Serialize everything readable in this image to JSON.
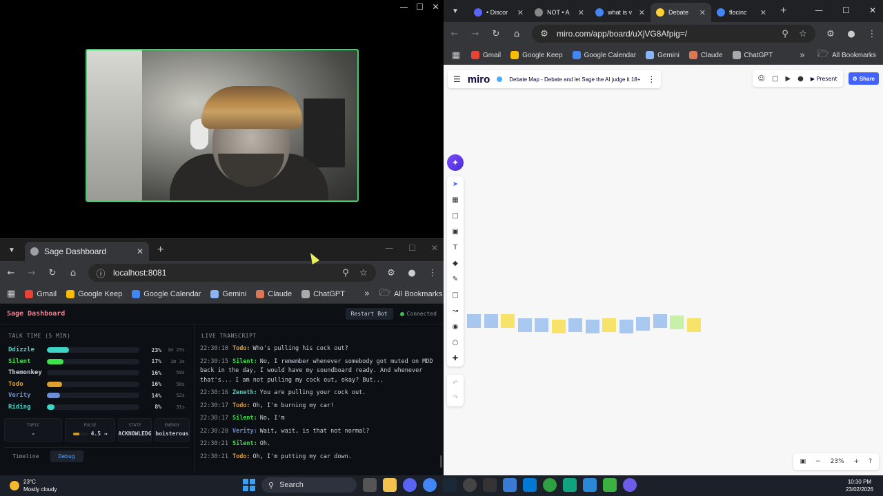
{
  "dashboard_browser": {
    "tab_title": "Sage Dashboard",
    "url": "localhost:8081",
    "bookmarks": [
      "Gmail",
      "Google Keep",
      "Google Calendar",
      "Gemini",
      "Claude",
      "ChatGPT"
    ],
    "all_bookmarks": "All Bookmarks"
  },
  "dashboard": {
    "title": "Sage Dashboard",
    "restart_label": "Restart Bot",
    "status": "Connected",
    "talk_time_label": "TALK TIME (5 MIN)",
    "talk": [
      {
        "name": "Ddizzle",
        "pct": "23%",
        "dur": "1m 23s",
        "fill": 0.23,
        "color": "#3dd6c6"
      },
      {
        "name": "Silent",
        "pct": "17%",
        "dur": "1m 3s",
        "fill": 0.17,
        "color": "#3fe04a"
      },
      {
        "name": "Themonkey",
        "pct": "16%",
        "dur": "59s",
        "fill": 0.0,
        "color": "#c9d1d9"
      },
      {
        "name": "Todo",
        "pct": "16%",
        "dur": "58s",
        "fill": 0.16,
        "color": "#e0a030"
      },
      {
        "name": "Verity",
        "pct": "14%",
        "dur": "52s",
        "fill": 0.14,
        "color": "#6b8fd6"
      },
      {
        "name": "Riding",
        "pct": "8%",
        "dur": "31s",
        "fill": 0.08,
        "color": "#3dd6c6"
      }
    ],
    "cards": {
      "topic_label": "TOPIC",
      "topic_value": "-",
      "pulse_label": "PULSE",
      "pulse_value": "4.5 →",
      "pulse_fill": 0.45,
      "state_label": "STATE",
      "state_value": "ACKNOWLEDG",
      "energy_label": "ENERGY",
      "energy_value": "boisterous"
    },
    "subtabs": [
      "Timeline",
      "Debug"
    ],
    "transcript_label": "LIVE TRANSCRIPT",
    "transcript": [
      {
        "time": "22:30:10",
        "speaker": "Todo:",
        "color": "#e0a030",
        "text": "Who's pulling his cock out?"
      },
      {
        "time": "22:30:15",
        "speaker": "Silent:",
        "color": "#3fe04a",
        "text": "No, I remember whenever somebody got muted on MDD back in the day, I would have my soundboard ready. And whenever that's... I am not pulling my cock out, okay? But..."
      },
      {
        "time": "22:30:16",
        "speaker": "Zeneth:",
        "color": "#3dd6c6",
        "text": "You are pulling your cock out."
      },
      {
        "time": "22:30:17",
        "speaker": "Todo:",
        "color": "#e0a030",
        "text": "Oh, I'm burning my car!"
      },
      {
        "time": "22:30:17",
        "speaker": "Silent:",
        "color": "#3fe04a",
        "text": "No, I'm"
      },
      {
        "time": "22:30:20",
        "speaker": "Verity:",
        "color": "#6b8fd6",
        "text": "Wait, wait, is that not normal?"
      },
      {
        "time": "22:30:21",
        "speaker": "Silent:",
        "color": "#3fe04a",
        "text": "Oh."
      },
      {
        "time": "22:30:21",
        "speaker": "Todo:",
        "color": "#e0a030",
        "text": "Oh, I'm putting my car down."
      }
    ]
  },
  "miro_browser": {
    "tabs": [
      {
        "title": "• Discor",
        "color": "#5865f2"
      },
      {
        "title": "NOT • A",
        "color": "#888"
      },
      {
        "title": "what is v",
        "color": "#4285f4"
      },
      {
        "title": "Debate",
        "color": "#ffd02f"
      },
      {
        "title": "flocinc",
        "color": "#4285f4"
      }
    ],
    "url": "miro.com/app/board/uXjVG8Afpig=/",
    "bookmarks": [
      "Gmail",
      "Google Keep",
      "Google Calendar",
      "Gemini",
      "Claude",
      "ChatGPT"
    ],
    "all_bookmarks": "All Bookmarks"
  },
  "miro": {
    "logo": "miro",
    "board_name": "Debate Map - Debate and let Sage the AI judge it 18+",
    "present_label": "Present",
    "share_label": "Share",
    "zoom": "23%",
    "sticky_colors": [
      "#a8c8f0",
      "#a8c8f0",
      "#f7e36a",
      "#a8c8f0",
      "#a8c8f0",
      "#f7e36a",
      "#a8c8f0",
      "#a8c8f0",
      "#f7e36a",
      "#a8c8f0",
      "#a8c8f0",
      "#a8c8f0",
      "#c8f0a8",
      "#f7e36a"
    ]
  },
  "taskbar": {
    "temp": "23°C",
    "weather": "Mostly cloudy",
    "search": "Search",
    "time": "10:30 PM",
    "date": "23/02/2026"
  }
}
